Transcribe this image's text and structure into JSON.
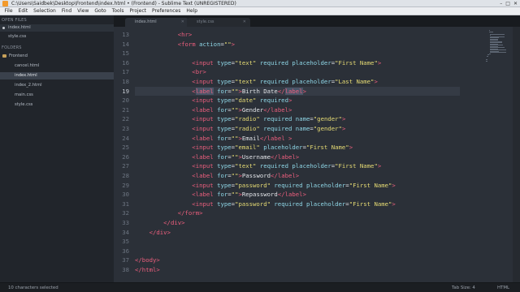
{
  "window": {
    "title": "C:\\Users\\Saidbek\\Desktop\\Frontend\\index.html • (Frontend) - Sublime Text (UNREGISTERED)",
    "controls": [
      "–",
      "□",
      "✕"
    ]
  },
  "menu": [
    "File",
    "Edit",
    "Selection",
    "Find",
    "View",
    "Goto",
    "Tools",
    "Project",
    "Preferences",
    "Help"
  ],
  "sidebar": {
    "open_files_header": "OPEN FILES",
    "open_files": [
      {
        "label": "index.html",
        "modified": true
      },
      {
        "label": "style.css",
        "modified": false
      }
    ],
    "folders_header": "FOLDERS",
    "folder": "Frontend",
    "files": [
      "cancel.html",
      "index.html",
      "index_2.html",
      "main.css",
      "style.css"
    ],
    "selected_file_index": 1
  },
  "tabs": [
    {
      "label": "index.html",
      "active": true
    },
    {
      "label": "style.css",
      "active": false
    }
  ],
  "editor": {
    "current_line": 19,
    "lines": [
      {
        "num": "13",
        "indent": 6,
        "tokens": [
          [
            "t",
            "<"
          ],
          [
            "t",
            "hr"
          ],
          [
            "t",
            ">"
          ]
        ]
      },
      {
        "num": "14",
        "indent": 6,
        "tokens": [
          [
            "t",
            "<"
          ],
          [
            "t",
            "form"
          ],
          [
            "x",
            " "
          ],
          [
            "a",
            "action"
          ],
          [
            "x",
            "="
          ],
          [
            "s",
            "\"\""
          ],
          [
            "t",
            ">"
          ]
        ]
      },
      {
        "num": "15",
        "indent": 0,
        "tokens": []
      },
      {
        "num": "16",
        "indent": 8,
        "tokens": [
          [
            "t",
            "<"
          ],
          [
            "t",
            "input"
          ],
          [
            "x",
            " "
          ],
          [
            "a",
            "type"
          ],
          [
            "x",
            "="
          ],
          [
            "s",
            "\"text\""
          ],
          [
            "x",
            " "
          ],
          [
            "a",
            "required"
          ],
          [
            "x",
            " "
          ],
          [
            "a",
            "placeholder"
          ],
          [
            "x",
            "="
          ],
          [
            "s",
            "\"First Name\""
          ],
          [
            "t",
            ">"
          ]
        ]
      },
      {
        "num": "17",
        "indent": 8,
        "tokens": [
          [
            "t",
            "<"
          ],
          [
            "t",
            "br"
          ],
          [
            "t",
            ">"
          ]
        ]
      },
      {
        "num": "18",
        "indent": 8,
        "tokens": [
          [
            "t",
            "<"
          ],
          [
            "t",
            "input"
          ],
          [
            "x",
            " "
          ],
          [
            "a",
            "type"
          ],
          [
            "x",
            "="
          ],
          [
            "s",
            "\"text\""
          ],
          [
            "x",
            " "
          ],
          [
            "a",
            "required"
          ],
          [
            "x",
            " "
          ],
          [
            "a",
            "placeholder"
          ],
          [
            "x",
            "="
          ],
          [
            "s",
            "\"Last Name\""
          ],
          [
            "t",
            ">"
          ]
        ]
      },
      {
        "num": "19",
        "indent": 8,
        "tokens": [
          [
            "t",
            "<"
          ],
          [
            "h",
            "label"
          ],
          [
            "x",
            " "
          ],
          [
            "a",
            "for"
          ],
          [
            "x",
            "="
          ],
          [
            "s",
            "\"\""
          ],
          [
            "t",
            ">"
          ],
          [
            "x",
            "Birth Date"
          ],
          [
            "t",
            "</"
          ],
          [
            "h",
            "label"
          ],
          [
            "t",
            ">"
          ]
        ]
      },
      {
        "num": "20",
        "indent": 8,
        "tokens": [
          [
            "t",
            "<"
          ],
          [
            "t",
            "input"
          ],
          [
            "x",
            " "
          ],
          [
            "a",
            "type"
          ],
          [
            "x",
            "="
          ],
          [
            "s",
            "\"date\""
          ],
          [
            "x",
            " "
          ],
          [
            "a",
            "required"
          ],
          [
            "t",
            ">"
          ]
        ]
      },
      {
        "num": "21",
        "indent": 8,
        "tokens": [
          [
            "t",
            "<"
          ],
          [
            "t",
            "label"
          ],
          [
            "x",
            " "
          ],
          [
            "a",
            "for"
          ],
          [
            "x",
            "="
          ],
          [
            "s",
            "\"\""
          ],
          [
            "t",
            ">"
          ],
          [
            "x",
            "Gender"
          ],
          [
            "t",
            "</"
          ],
          [
            "t",
            "label"
          ],
          [
            "t",
            ">"
          ]
        ]
      },
      {
        "num": "22",
        "indent": 8,
        "tokens": [
          [
            "t",
            "<"
          ],
          [
            "t",
            "input"
          ],
          [
            "x",
            " "
          ],
          [
            "a",
            "type"
          ],
          [
            "x",
            "="
          ],
          [
            "s",
            "\"radio\""
          ],
          [
            "x",
            " "
          ],
          [
            "a",
            "required"
          ],
          [
            "x",
            " "
          ],
          [
            "a",
            "name"
          ],
          [
            "x",
            "="
          ],
          [
            "s",
            "\"gender\""
          ],
          [
            "t",
            ">"
          ]
        ]
      },
      {
        "num": "23",
        "indent": 8,
        "tokens": [
          [
            "t",
            "<"
          ],
          [
            "t",
            "input"
          ],
          [
            "x",
            " "
          ],
          [
            "a",
            "type"
          ],
          [
            "x",
            "="
          ],
          [
            "s",
            "\"radio\""
          ],
          [
            "x",
            " "
          ],
          [
            "a",
            "required"
          ],
          [
            "x",
            " "
          ],
          [
            "a",
            "name"
          ],
          [
            "x",
            "="
          ],
          [
            "s",
            "\"gender\""
          ],
          [
            "t",
            ">"
          ]
        ]
      },
      {
        "num": "24",
        "indent": 8,
        "tokens": [
          [
            "t",
            "<"
          ],
          [
            "t",
            "label"
          ],
          [
            "x",
            " "
          ],
          [
            "a",
            "for"
          ],
          [
            "x",
            "="
          ],
          [
            "s",
            "\"\""
          ],
          [
            "t",
            ">"
          ],
          [
            "x",
            "Email"
          ],
          [
            "t",
            "</"
          ],
          [
            "t",
            "label"
          ],
          [
            "x",
            " "
          ],
          [
            "t",
            ">"
          ]
        ]
      },
      {
        "num": "25",
        "indent": 8,
        "tokens": [
          [
            "t",
            "<"
          ],
          [
            "t",
            "input"
          ],
          [
            "x",
            " "
          ],
          [
            "a",
            "type"
          ],
          [
            "x",
            "="
          ],
          [
            "s",
            "\"email\""
          ],
          [
            "x",
            " "
          ],
          [
            "a",
            "placeholder"
          ],
          [
            "x",
            "="
          ],
          [
            "s",
            "\"First Name\""
          ],
          [
            "t",
            ">"
          ]
        ]
      },
      {
        "num": "26",
        "indent": 8,
        "tokens": [
          [
            "t",
            "<"
          ],
          [
            "t",
            "label"
          ],
          [
            "x",
            " "
          ],
          [
            "a",
            "for"
          ],
          [
            "x",
            "="
          ],
          [
            "s",
            "\"\""
          ],
          [
            "t",
            ">"
          ],
          [
            "x",
            "Username"
          ],
          [
            "t",
            "</"
          ],
          [
            "t",
            "label"
          ],
          [
            "t",
            ">"
          ]
        ]
      },
      {
        "num": "27",
        "indent": 8,
        "tokens": [
          [
            "t",
            "<"
          ],
          [
            "t",
            "input"
          ],
          [
            "x",
            " "
          ],
          [
            "a",
            "type"
          ],
          [
            "x",
            "="
          ],
          [
            "s",
            "\"text\""
          ],
          [
            "x",
            " "
          ],
          [
            "a",
            "required"
          ],
          [
            "x",
            " "
          ],
          [
            "a",
            "placeholder"
          ],
          [
            "x",
            "="
          ],
          [
            "s",
            "\"First Name\""
          ],
          [
            "t",
            ">"
          ]
        ]
      },
      {
        "num": "28",
        "indent": 8,
        "tokens": [
          [
            "t",
            "<"
          ],
          [
            "t",
            "label"
          ],
          [
            "x",
            " "
          ],
          [
            "a",
            "for"
          ],
          [
            "x",
            "="
          ],
          [
            "s",
            "\"\""
          ],
          [
            "t",
            ">"
          ],
          [
            "x",
            "Password"
          ],
          [
            "t",
            "</"
          ],
          [
            "t",
            "label"
          ],
          [
            "t",
            ">"
          ]
        ]
      },
      {
        "num": "29",
        "indent": 8,
        "tokens": [
          [
            "t",
            "<"
          ],
          [
            "t",
            "input"
          ],
          [
            "x",
            " "
          ],
          [
            "a",
            "type"
          ],
          [
            "x",
            "="
          ],
          [
            "s",
            "\"password\""
          ],
          [
            "x",
            " "
          ],
          [
            "a",
            "required"
          ],
          [
            "x",
            " "
          ],
          [
            "a",
            "placeholder"
          ],
          [
            "x",
            "="
          ],
          [
            "s",
            "\"First Name\""
          ],
          [
            "t",
            ">"
          ]
        ]
      },
      {
        "num": "30",
        "indent": 8,
        "tokens": [
          [
            "t",
            "<"
          ],
          [
            "t",
            "label"
          ],
          [
            "x",
            " "
          ],
          [
            "a",
            "for"
          ],
          [
            "x",
            "="
          ],
          [
            "s",
            "\"\""
          ],
          [
            "t",
            ">"
          ],
          [
            "x",
            "Repassword"
          ],
          [
            "t",
            "</"
          ],
          [
            "t",
            "label"
          ],
          [
            "t",
            ">"
          ]
        ]
      },
      {
        "num": "31",
        "indent": 8,
        "tokens": [
          [
            "t",
            "<"
          ],
          [
            "t",
            "input"
          ],
          [
            "x",
            " "
          ],
          [
            "a",
            "type"
          ],
          [
            "x",
            "="
          ],
          [
            "s",
            "\"password\""
          ],
          [
            "x",
            " "
          ],
          [
            "a",
            "required"
          ],
          [
            "x",
            " "
          ],
          [
            "a",
            "placeholder"
          ],
          [
            "x",
            "="
          ],
          [
            "s",
            "\"First Name\""
          ],
          [
            "t",
            ">"
          ]
        ]
      },
      {
        "num": "32",
        "indent": 6,
        "tokens": [
          [
            "t",
            "</"
          ],
          [
            "t",
            "form"
          ],
          [
            "t",
            ">"
          ]
        ]
      },
      {
        "num": "33",
        "indent": 4,
        "tokens": [
          [
            "t",
            "</"
          ],
          [
            "t",
            "div"
          ],
          [
            "t",
            ">"
          ]
        ]
      },
      {
        "num": "34",
        "indent": 2,
        "tokens": [
          [
            "t",
            "</"
          ],
          [
            "t",
            "div"
          ],
          [
            "t",
            ">"
          ]
        ]
      },
      {
        "num": "35",
        "indent": 0,
        "tokens": []
      },
      {
        "num": "36",
        "indent": 0,
        "tokens": []
      },
      {
        "num": "37",
        "indent": 0,
        "tokens": [
          [
            "t",
            "</"
          ],
          [
            "t",
            "body"
          ],
          [
            "t",
            ">"
          ]
        ]
      },
      {
        "num": "38",
        "indent": 0,
        "tokens": [
          [
            "t",
            "</"
          ],
          [
            "t",
            "html"
          ],
          [
            "t",
            ">"
          ]
        ]
      }
    ]
  },
  "status": {
    "left": "10 characters selected",
    "tab_size": "Tab Size: 4",
    "syntax": "HTML"
  },
  "colors": {
    "tag": "#ed5f7e",
    "attribute": "#8fd7e7",
    "string": "#e6db74",
    "text": "#e2e4e8",
    "background": "#2b3038"
  }
}
